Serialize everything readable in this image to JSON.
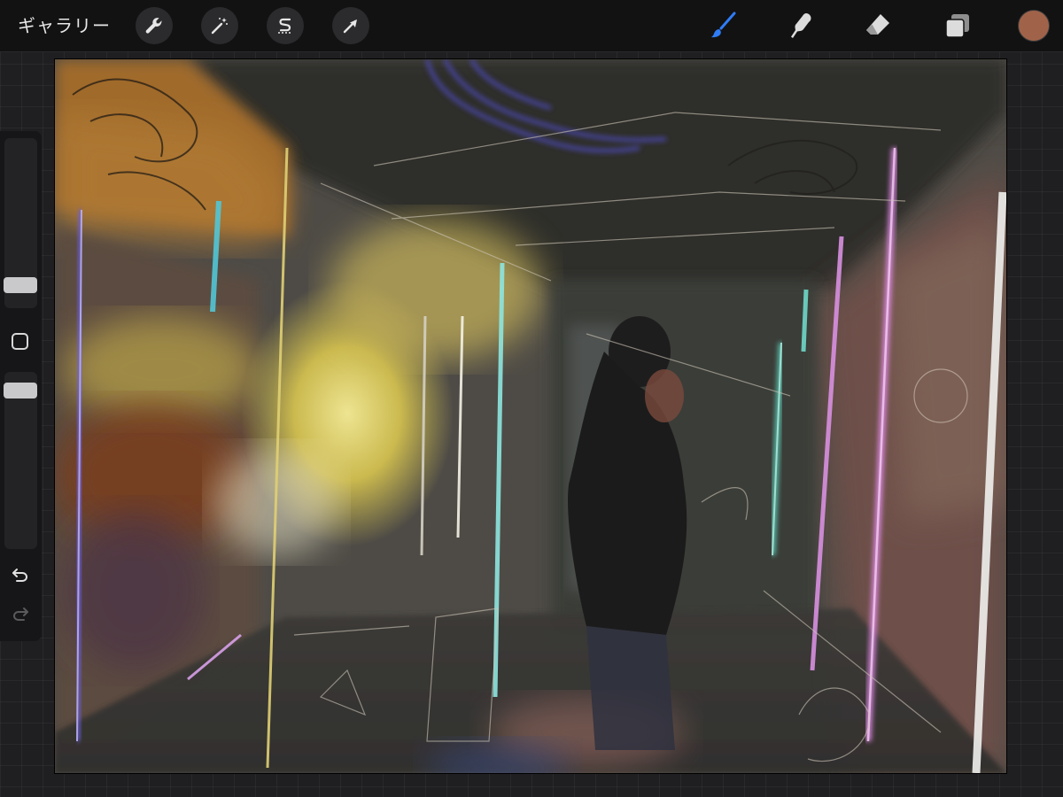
{
  "toolbar": {
    "gallery_label": "ギャラリー",
    "left_tools": [
      {
        "icon": "wrench-icon",
        "name": "actions"
      },
      {
        "icon": "magic-wand-icon",
        "name": "adjustments"
      },
      {
        "icon": "selection-s-icon",
        "name": "selection"
      },
      {
        "icon": "arrow-cursor-icon",
        "name": "transform"
      }
    ],
    "right_tools": [
      {
        "icon": "brush-icon",
        "name": "paint",
        "active": true
      },
      {
        "icon": "smudge-finger-icon",
        "name": "smudge",
        "active": false
      },
      {
        "icon": "eraser-icon",
        "name": "erase",
        "active": false
      },
      {
        "icon": "layers-icon",
        "name": "layers",
        "active": false
      }
    ],
    "active_color": "#a0634a",
    "accent_color": "#2f7cf6"
  },
  "sidebar": {
    "brush_size_level": 0.3,
    "opacity_level": 0.65,
    "undo_icon": "undo-arrow-icon",
    "redo_icon": "redo-arrow-icon",
    "modify_icon": "square-modify-icon"
  },
  "canvas": {
    "content": "digital-painting"
  }
}
